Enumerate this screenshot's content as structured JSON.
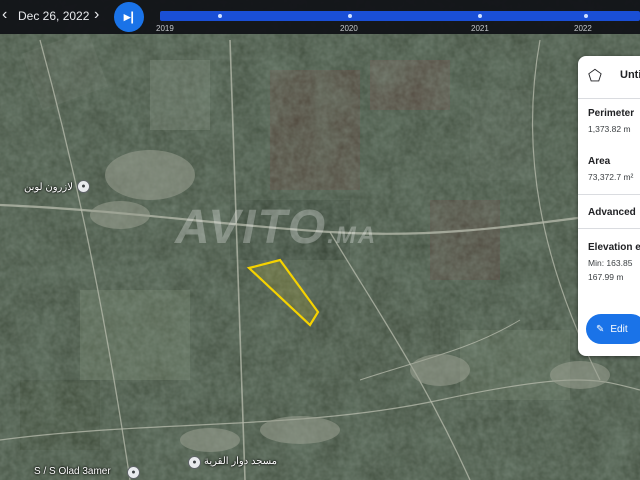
{
  "timeline": {
    "date": "Dec 26, 2022",
    "years": [
      "2019",
      "2020",
      "2021",
      "2022"
    ],
    "prev_icon": "chevron-left-icon",
    "next_icon": "chevron-right-icon",
    "jump_icon": "skip-to-end-icon"
  },
  "panel": {
    "title": "Unti",
    "perimeter_label": "Perimeter",
    "perimeter_value": "1,373.82 m",
    "area_label": "Area",
    "area_value": "73,372.7 m²",
    "advanced_label": "Advanced",
    "elevation_label": "Elevation e",
    "elevation_min": "Min: 163.85",
    "elevation_max": "167.99 m",
    "edit_label": "Edit"
  },
  "places": [
    {
      "label": "لازرون لوبن"
    },
    {
      "label": "S / S Olad 3amer"
    },
    {
      "label": "مسجد دوار القرية"
    }
  ],
  "watermark": {
    "main": "AVITO",
    "suffix": ".MA"
  },
  "colors": {
    "polygon": "#f5d200",
    "accent": "#1a73e8",
    "timebar": "#121418"
  }
}
